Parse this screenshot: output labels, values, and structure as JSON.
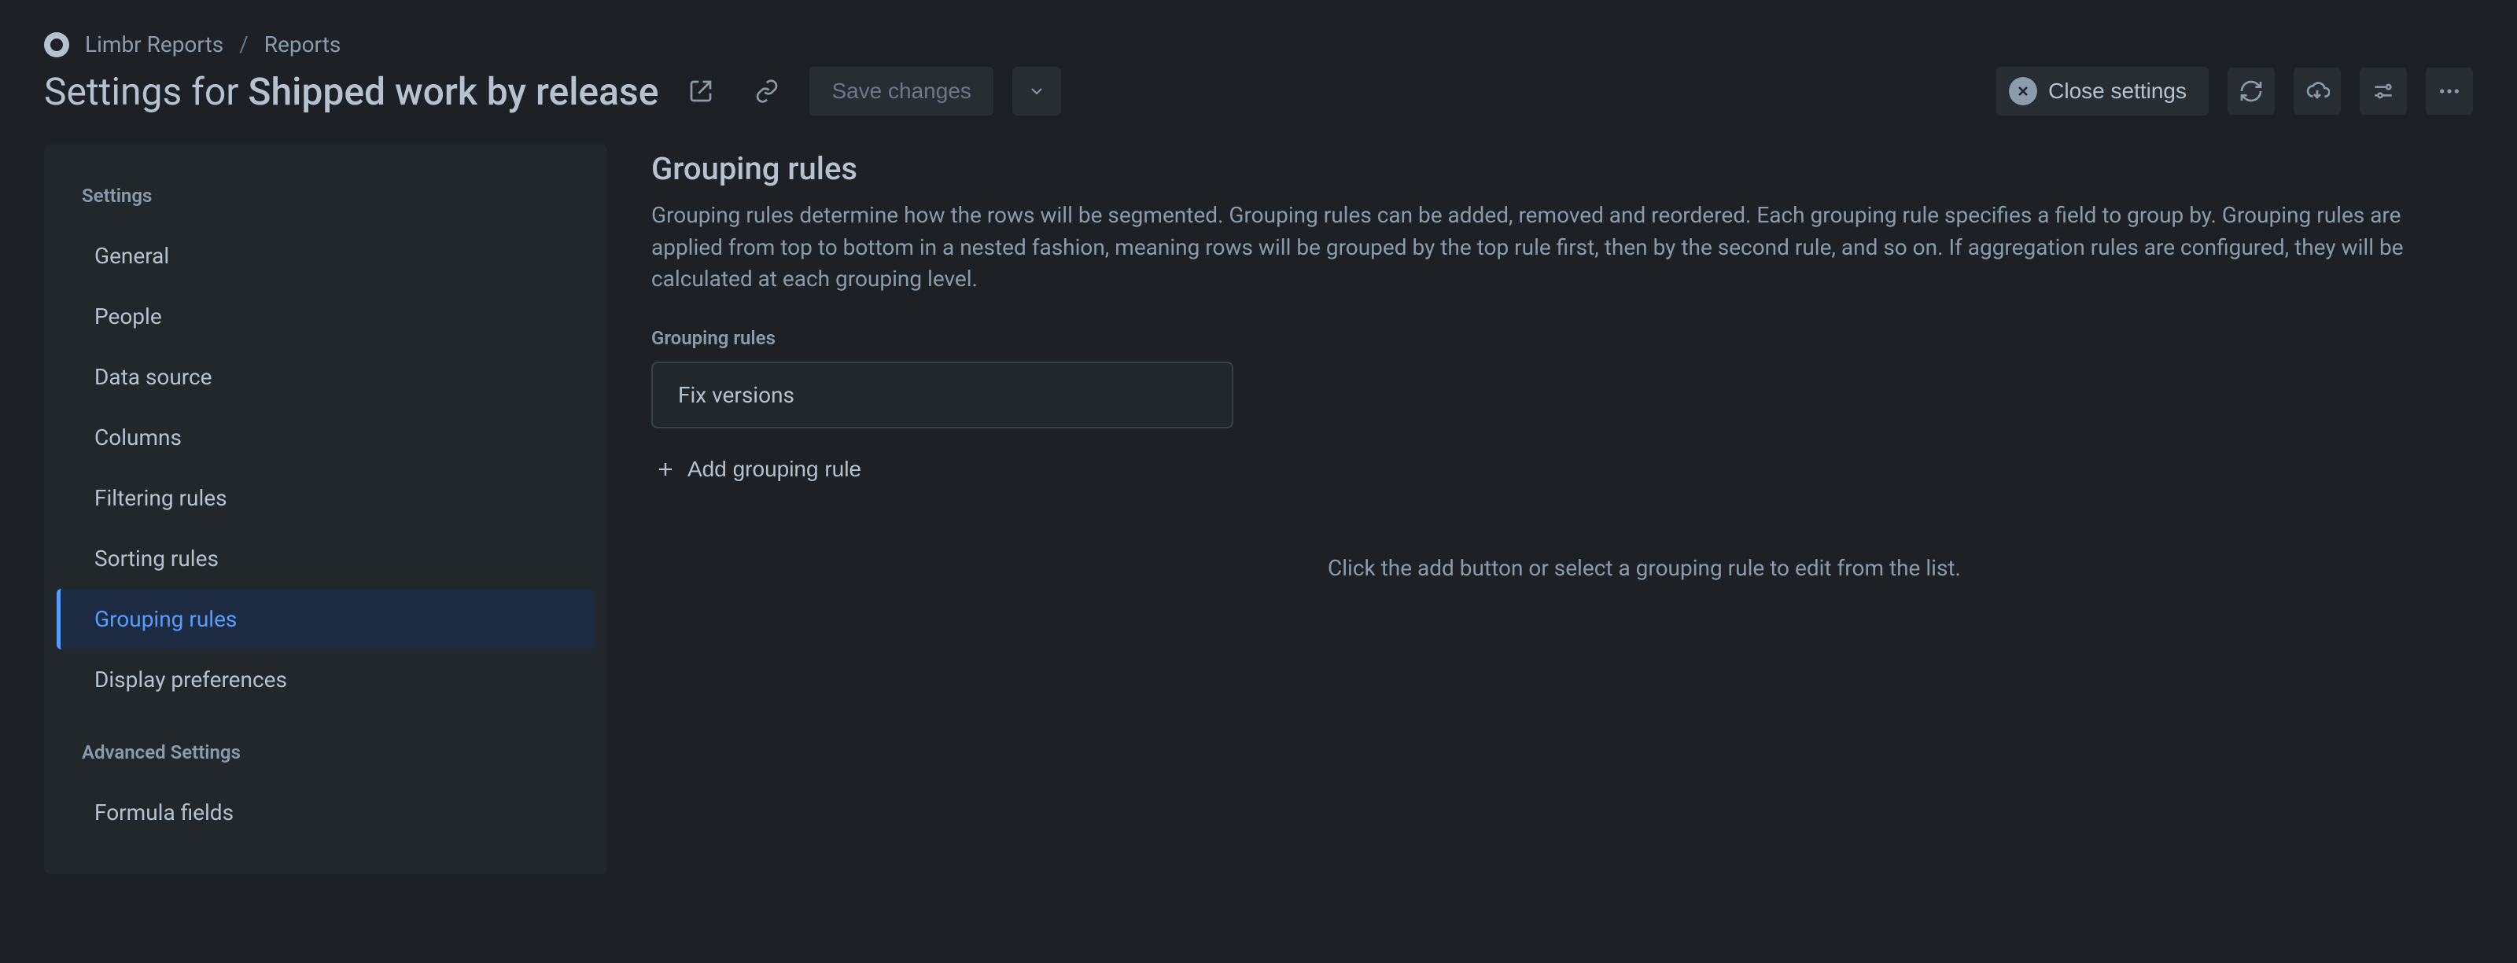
{
  "breadcrumbs": {
    "app": "Limbr Reports",
    "section": "Reports"
  },
  "page": {
    "title_prefix": "Settings for ",
    "title_name": "Shipped work by release"
  },
  "header": {
    "save_label": "Save changes",
    "close_label": "Close settings"
  },
  "sidebar": {
    "section1_label": "Settings",
    "section2_label": "Advanced Settings",
    "items": [
      {
        "label": "General"
      },
      {
        "label": "People"
      },
      {
        "label": "Data source"
      },
      {
        "label": "Columns"
      },
      {
        "label": "Filtering rules"
      },
      {
        "label": "Sorting rules"
      },
      {
        "label": "Grouping rules"
      },
      {
        "label": "Display preferences"
      }
    ],
    "advanced_items": [
      {
        "label": "Formula fields"
      }
    ]
  },
  "main": {
    "heading": "Grouping rules",
    "help_text": "Grouping rules determine how the rows will be segmented. Grouping rules can be added, removed and reordered. Each grouping rule specifies a field to group by. Grouping rules are applied from top to bottom in a nested fashion, meaning rows will be grouped by the top rule first, then by the second rule, and so on. If aggregation rules are configured, they will be calculated at each grouping level.",
    "list_label": "Grouping rules",
    "rules": [
      {
        "label": "Fix versions"
      }
    ],
    "add_label": "Add grouping rule",
    "hint": "Click the add button or select a grouping rule to edit from the list."
  }
}
